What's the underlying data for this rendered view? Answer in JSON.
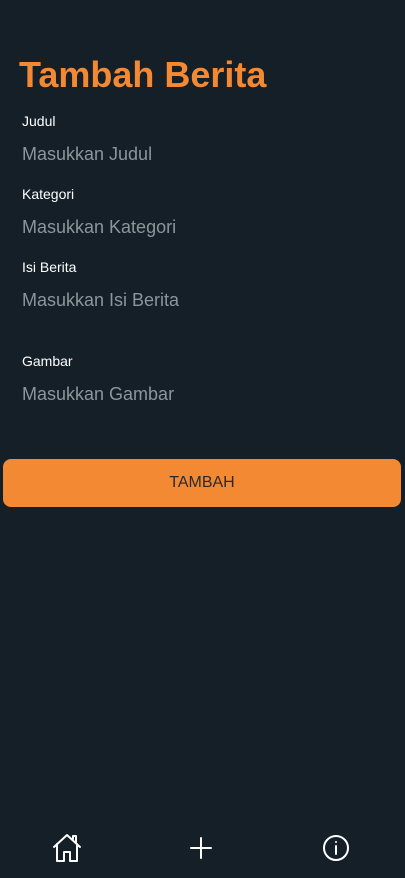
{
  "page": {
    "title": "Tambah Berita"
  },
  "form": {
    "judul": {
      "label": "Judul",
      "placeholder": "Masukkan Judul",
      "value": ""
    },
    "kategori": {
      "label": "Kategori",
      "placeholder": "Masukkan Kategori",
      "value": ""
    },
    "isi": {
      "label": "Isi Berita",
      "placeholder": "Masukkan Isi Berita",
      "value": ""
    },
    "gambar": {
      "label": "Gambar",
      "placeholder": "Masukkan Gambar",
      "value": ""
    }
  },
  "actions": {
    "submit_label": "TAMBAH"
  },
  "bottom_nav": {
    "items": [
      {
        "icon": "home-icon"
      },
      {
        "icon": "plus-icon"
      },
      {
        "icon": "info-icon"
      }
    ]
  },
  "colors": {
    "background": "#141f27",
    "accent": "#f38a33",
    "label": "#ffffff",
    "placeholder": "#8d959b"
  }
}
